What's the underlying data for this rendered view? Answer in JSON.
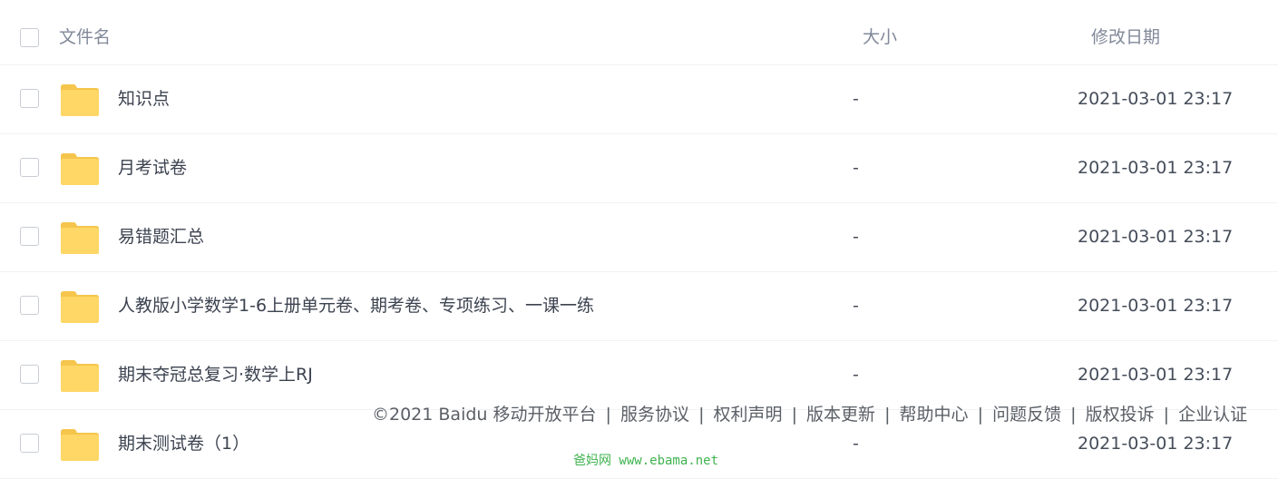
{
  "header": {
    "filename_label": "文件名",
    "size_label": "大小",
    "modified_label": "修改日期"
  },
  "colors": {
    "folder_body": "#ffd766",
    "folder_tab": "#f5c54c",
    "watermark": "#3fb34f"
  },
  "rows": [
    {
      "name": "知识点",
      "size": "-",
      "modified": "2021-03-01 23:17",
      "icon": "folder-icon"
    },
    {
      "name": "月考试卷",
      "size": "-",
      "modified": "2021-03-01 23:17",
      "icon": "folder-icon"
    },
    {
      "name": "易错题汇总",
      "size": "-",
      "modified": "2021-03-01 23:17",
      "icon": "folder-icon"
    },
    {
      "name": "人教版小学数学1-6上册单元卷、期考卷、专项练习、一课一练",
      "size": "-",
      "modified": "2021-03-01 23:17",
      "icon": "folder-icon"
    },
    {
      "name": "期末夺冠总复习·数学上RJ",
      "size": "-",
      "modified": "2021-03-01 23:17",
      "icon": "folder-icon"
    },
    {
      "name": "期末测试卷（1）",
      "size": "-",
      "modified": "2021-03-01 23:17",
      "icon": "folder-icon"
    }
  ],
  "footer": {
    "copyright": "©2021 Baidu  移动开放平台",
    "links": [
      "服务协议",
      "权利声明",
      "版本更新",
      "帮助中心",
      "问题反馈",
      "版权投诉",
      "企业认证"
    ],
    "separator": "|"
  },
  "watermark": "爸妈网 www.ebama.net"
}
